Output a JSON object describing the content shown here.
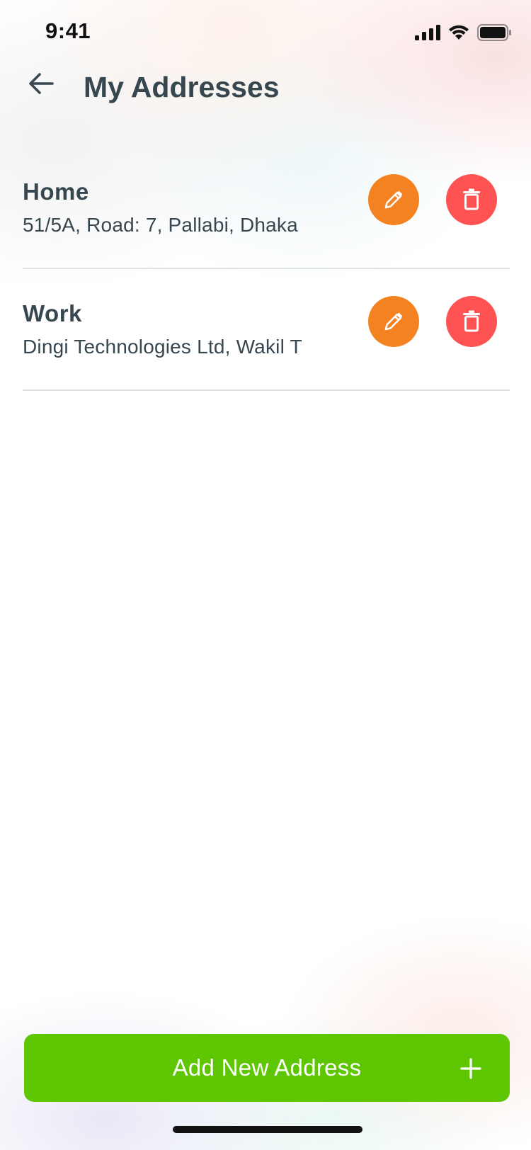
{
  "status_bar": {
    "time": "9:41",
    "icons": [
      "signal-icon",
      "wifi-icon",
      "battery-icon"
    ]
  },
  "header": {
    "back_icon": "arrow-left-icon",
    "title": "My Addresses"
  },
  "addresses": [
    {
      "label": "Home",
      "address": "51/5A, Road: 7, Pallabi, Dhaka"
    },
    {
      "label": "Work",
      "address": "Dingi Technologies Ltd, Wakil T"
    }
  ],
  "actions": {
    "edit_icon": "pencil-icon",
    "delete_icon": "trash-icon"
  },
  "add_button": {
    "label": "Add New Address",
    "icon": "plus-icon"
  },
  "colors": {
    "edit": "#f58220",
    "delete": "#ff5252",
    "primary": "#5ec603",
    "text": "#37474f"
  }
}
